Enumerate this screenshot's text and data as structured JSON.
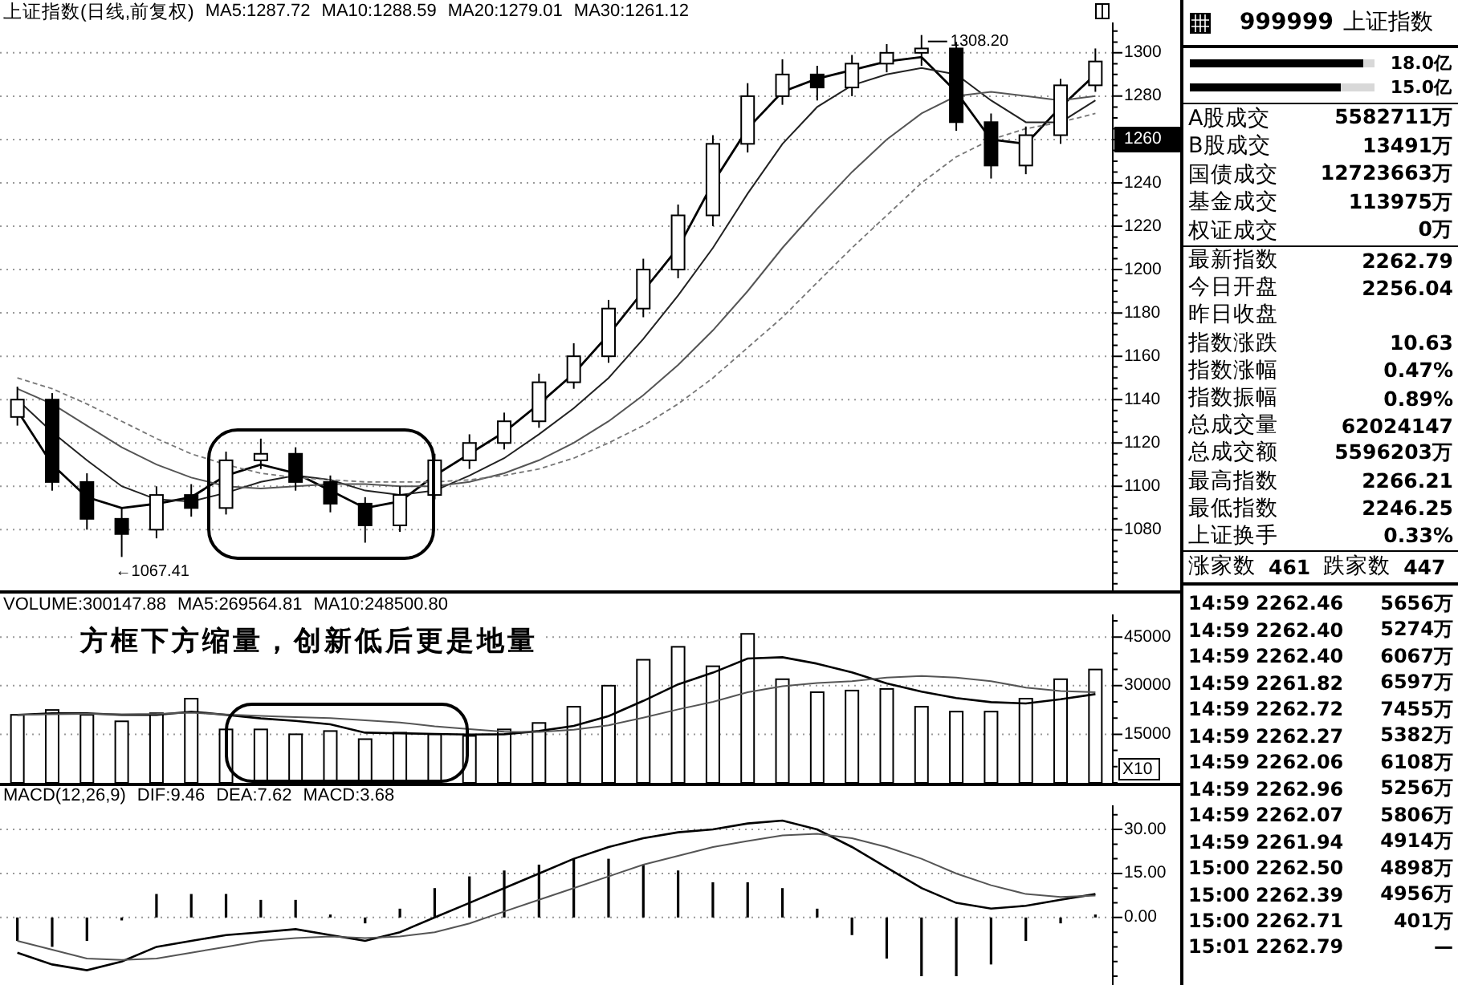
{
  "price_chart": {
    "chart_data": {
      "type": "candlestick",
      "title": "上证指数(日线,前复权)",
      "ylim": [
        1052,
        1314
      ],
      "yticks": [
        1080,
        1100,
        1120,
        1140,
        1160,
        1180,
        1200,
        1220,
        1240,
        1260,
        1280,
        1300
      ],
      "grid": true,
      "ohlc": [
        [
          1132,
          1146,
          1128,
          1140
        ],
        [
          1140,
          1143,
          1098,
          1102
        ],
        [
          1102,
          1106,
          1080,
          1085
        ],
        [
          1085,
          1090,
          1067.41,
          1078
        ],
        [
          1080,
          1100,
          1076,
          1096
        ],
        [
          1096,
          1101,
          1086,
          1090
        ],
        [
          1090,
          1116,
          1087,
          1112
        ],
        [
          1112,
          1122,
          1108,
          1115
        ],
        [
          1115,
          1118,
          1098,
          1102
        ],
        [
          1102,
          1105,
          1088,
          1092
        ],
        [
          1092,
          1095,
          1074,
          1082
        ],
        [
          1082,
          1100,
          1079,
          1096
        ],
        [
          1096,
          1115,
          1094,
          1112
        ],
        [
          1112,
          1124,
          1108,
          1120
        ],
        [
          1120,
          1134,
          1117,
          1130
        ],
        [
          1130,
          1152,
          1127,
          1148
        ],
        [
          1148,
          1166,
          1145,
          1160
        ],
        [
          1160,
          1186,
          1157,
          1182
        ],
        [
          1182,
          1205,
          1178,
          1200
        ],
        [
          1200,
          1230,
          1196,
          1225
        ],
        [
          1225,
          1262,
          1220,
          1258
        ],
        [
          1258,
          1286,
          1254,
          1280
        ],
        [
          1280,
          1297,
          1276,
          1290
        ],
        [
          1290,
          1294,
          1278,
          1284
        ],
        [
          1284,
          1299,
          1280,
          1295
        ],
        [
          1295,
          1304,
          1291,
          1300
        ],
        [
          1300,
          1308.2,
          1294,
          1302
        ],
        [
          1302,
          1305,
          1264,
          1268
        ],
        [
          1268,
          1272,
          1242,
          1248
        ],
        [
          1248,
          1266,
          1244,
          1262
        ],
        [
          1262,
          1288,
          1258,
          1285
        ],
        [
          1285,
          1302,
          1282,
          1296
        ]
      ],
      "series": [
        {
          "name": "MA5:1287.72",
          "type": "line",
          "values": [
            1135,
            1110,
            1095,
            1090,
            1092,
            1095,
            1105,
            1110,
            1106,
            1098,
            1090,
            1093,
            1105,
            1115,
            1125,
            1138,
            1152,
            1170,
            1190,
            1210,
            1240,
            1265,
            1282,
            1288,
            1292,
            1296,
            1298,
            1282,
            1260,
            1258,
            1275,
            1290
          ]
        },
        {
          "name": "MA10:1288.59",
          "type": "line",
          "values": [
            1140,
            1125,
            1112,
            1100,
            1094,
            1093,
            1097,
            1102,
            1105,
            1103,
            1098,
            1096,
            1098,
            1105,
            1113,
            1124,
            1136,
            1150,
            1168,
            1188,
            1210,
            1235,
            1258,
            1275,
            1285,
            1290,
            1293,
            1290,
            1278,
            1268,
            1268,
            1278
          ]
        },
        {
          "name": "MA20:1279.01",
          "type": "line",
          "values": [
            1145,
            1138,
            1128,
            1118,
            1110,
            1104,
            1100,
            1099,
            1100,
            1101,
            1101,
            1100,
            1100,
            1102,
            1106,
            1112,
            1120,
            1130,
            1142,
            1156,
            1172,
            1190,
            1210,
            1228,
            1245,
            1260,
            1272,
            1280,
            1282,
            1280,
            1278,
            1280
          ]
        },
        {
          "name": "MA30:1261.12",
          "type": "line",
          "line_style": "dashed",
          "values": [
            1150,
            1145,
            1138,
            1130,
            1122,
            1115,
            1110,
            1106,
            1104,
            1103,
            1102,
            1102,
            1102,
            1103,
            1105,
            1108,
            1113,
            1120,
            1128,
            1138,
            1150,
            1164,
            1178,
            1194,
            1210,
            1225,
            1240,
            1252,
            1260,
            1265,
            1268,
            1272
          ]
        }
      ],
      "annotations": [
        "←1067.41",
        "1308.20"
      ]
    }
  },
  "volume_chart": {
    "note": "方框下方缩量，创新低后更是地量",
    "unit_label": "X10",
    "chart_data": {
      "type": "bar",
      "ylim": [
        0,
        52000
      ],
      "yticks": [
        15000,
        30000,
        45000
      ],
      "grid": true,
      "series": [
        {
          "name": "VOLUME:300147.88",
          "values": [
            21000,
            22500,
            21000,
            19000,
            21500,
            26000,
            16500,
            16500,
            15000,
            16000,
            13500,
            15500,
            15000,
            14500,
            16500,
            18500,
            23500,
            30000,
            38000,
            42000,
            36000,
            46000,
            32000,
            28000,
            28500,
            29000,
            23500,
            22000,
            22000,
            26000,
            32000,
            35000
          ]
        },
        {
          "name": "MA5:269564.81",
          "type": "line",
          "values": [
            21000,
            21500,
            21500,
            21000,
            21000,
            22000,
            21000,
            19900,
            19100,
            18100,
            15500,
            15300,
            15100,
            14900,
            15000,
            16000,
            17600,
            20600,
            25300,
            30400,
            34000,
            38400,
            38800,
            36800,
            34100,
            30700,
            28200,
            26200,
            24900,
            24500,
            25800,
            27400
          ]
        },
        {
          "name": "MA10:248500.80",
          "type": "line",
          "values": [
            21000,
            21200,
            21300,
            21200,
            21300,
            21700,
            21100,
            20700,
            20300,
            20000,
            19300,
            18600,
            17500,
            16600,
            15800,
            15700,
            16400,
            17800,
            20100,
            22700,
            25000,
            28000,
            29800,
            30800,
            31400,
            32500,
            33000,
            32500,
            31400,
            29400,
            28400,
            28000
          ]
        }
      ]
    }
  },
  "macd_chart": {
    "chart_data": {
      "type": "line",
      "title": "MACD(12,26,9)",
      "ylim": [
        -23,
        38.2
      ],
      "yticks": [
        {
          "value": 0,
          "label": "0.00"
        },
        {
          "value": 15,
          "label": "15.00"
        },
        {
          "value": 30,
          "label": "30.00"
        }
      ],
      "grid": true,
      "series": [
        {
          "name": "DIF:9.46",
          "values": [
            -12,
            -16,
            -18,
            -15,
            -10,
            -8,
            -6,
            -5,
            -4,
            -6,
            -8,
            -5,
            0,
            5,
            10,
            15,
            20,
            24,
            27,
            29,
            30,
            32,
            33,
            30,
            24,
            17,
            10,
            5,
            3,
            4,
            6,
            8
          ]
        },
        {
          "name": "DEA:7.62",
          "values": [
            -8,
            -11,
            -14,
            -14.5,
            -14,
            -12,
            -10,
            -8,
            -7,
            -6.5,
            -7,
            -6.5,
            -5,
            -2,
            2,
            6,
            10,
            14,
            18,
            21,
            24,
            26,
            28,
            28.5,
            27,
            24,
            20,
            15,
            11,
            8,
            7,
            7.5
          ]
        },
        {
          "name": "MACD:3.68",
          "type": "bar",
          "values": [
            -8,
            -10,
            -8,
            -1,
            8,
            8,
            8,
            6,
            6,
            1,
            -2,
            3,
            10,
            14,
            16,
            18,
            20,
            20,
            18,
            16,
            12,
            12,
            10,
            3,
            -6,
            -14,
            -20,
            -20,
            -16,
            -8,
            -2,
            1
          ]
        }
      ]
    }
  },
  "quote_panel": {
    "code": "999999",
    "name": "上证指数",
    "flow_bars": [
      {
        "label": "18.0亿",
        "level": 0.94
      },
      {
        "label": "15.0亿",
        "level": 0.82
      }
    ],
    "turnover": [
      {
        "label": "A股成交",
        "value": "5582711万"
      },
      {
        "label": "B股成交",
        "value": "13491万"
      },
      {
        "label": "国债成交",
        "value": "12723663万"
      },
      {
        "label": "基金成交",
        "value": "113975万"
      },
      {
        "label": "权证成交",
        "value": "0万"
      }
    ],
    "index_stats": [
      {
        "label": "最新指数",
        "value": "2262.79"
      },
      {
        "label": "今日开盘",
        "value": "2256.04"
      },
      {
        "label": "昨日收盘"
      },
      {
        "label": "指数涨跌",
        "value": "10.63"
      },
      {
        "label": "指数涨幅",
        "value": "0.47%"
      },
      {
        "label": "指数振幅",
        "value": "0.89%"
      },
      {
        "label": "总成交量",
        "value": "62024147"
      },
      {
        "label": "总成交额",
        "value": "5596203万"
      },
      {
        "label": "最高指数",
        "value": "2266.21"
      },
      {
        "label": "最低指数",
        "value": "2246.25"
      },
      {
        "label": "上证换手",
        "value": "0.33%"
      }
    ],
    "breadth": {
      "advancers_label": "涨家数",
      "advancers": "461",
      "decliners_label": "跌家数",
      "decliners": "447"
    },
    "trades": [
      {
        "time": "14:59",
        "price": "2262.46",
        "volume": "5656万"
      },
      {
        "time": "14:59",
        "price": "2262.40",
        "volume": "5274万"
      },
      {
        "time": "14:59",
        "price": "2262.40",
        "volume": "6067万"
      },
      {
        "time": "14:59",
        "price": "2261.82",
        "volume": "6597万"
      },
      {
        "time": "14:59",
        "price": "2262.72",
        "volume": "7455万"
      },
      {
        "time": "14:59",
        "price": "2262.27",
        "volume": "5382万"
      },
      {
        "time": "14:59",
        "price": "2262.06",
        "volume": "6108万"
      },
      {
        "time": "14:59",
        "price": "2262.96",
        "volume": "5256万"
      },
      {
        "time": "14:59",
        "price": "2262.07",
        "volume": "5806万"
      },
      {
        "time": "14:59",
        "price": "2261.94",
        "volume": "4914万"
      },
      {
        "time": "15:00",
        "price": "2262.50",
        "volume": "4898万"
      },
      {
        "time": "15:00",
        "price": "2262.39",
        "volume": "4956万"
      },
      {
        "time": "15:00",
        "price": "2262.71",
        "volume": "401万"
      },
      {
        "time": "15:01",
        "price": "2262.79",
        "volume": "—"
      }
    ]
  }
}
